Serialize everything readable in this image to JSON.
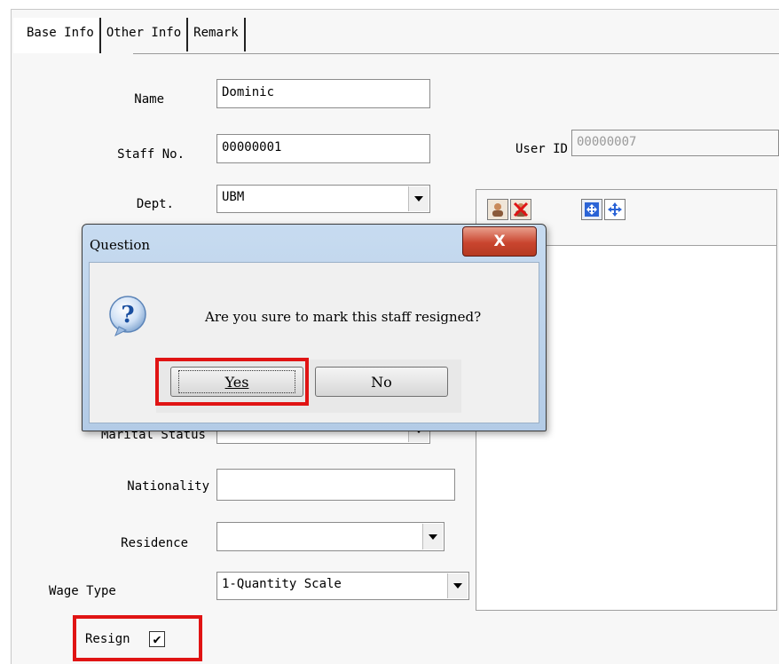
{
  "tabs": [
    "Base Info",
    "Other Info",
    "Remark"
  ],
  "form": {
    "name": {
      "label": "Name",
      "value": "Dominic"
    },
    "staff_no": {
      "label": "Staff No.",
      "value": "00000001"
    },
    "user_id": {
      "label": "User ID",
      "value": "00000007"
    },
    "dept": {
      "label": "Dept.",
      "value": "UBM"
    },
    "marital_status": {
      "label": "Marital Status",
      "value": ""
    },
    "nationality": {
      "label": "Nationality",
      "value": ""
    },
    "residence": {
      "label": "Residence",
      "value": ""
    },
    "wage_type": {
      "label": "Wage Type",
      "value": "1-Quantity Scale"
    },
    "resign": {
      "label": "Resign",
      "checked": true,
      "check_glyph": "✔"
    }
  },
  "photo_toolbar": [
    "person-icon",
    "person-remove-icon",
    "fit-icon",
    "move-icon"
  ],
  "dialog": {
    "title": "Question",
    "close_glyph": "X",
    "message": "Are you sure to mark this staff resigned?",
    "icon": "question-icon",
    "yes_label": "Yes",
    "no_label": "No"
  },
  "colors": {
    "highlight": "#e01414",
    "dialog_frame": "#b3cbe6",
    "close_button": "#c9452f"
  }
}
